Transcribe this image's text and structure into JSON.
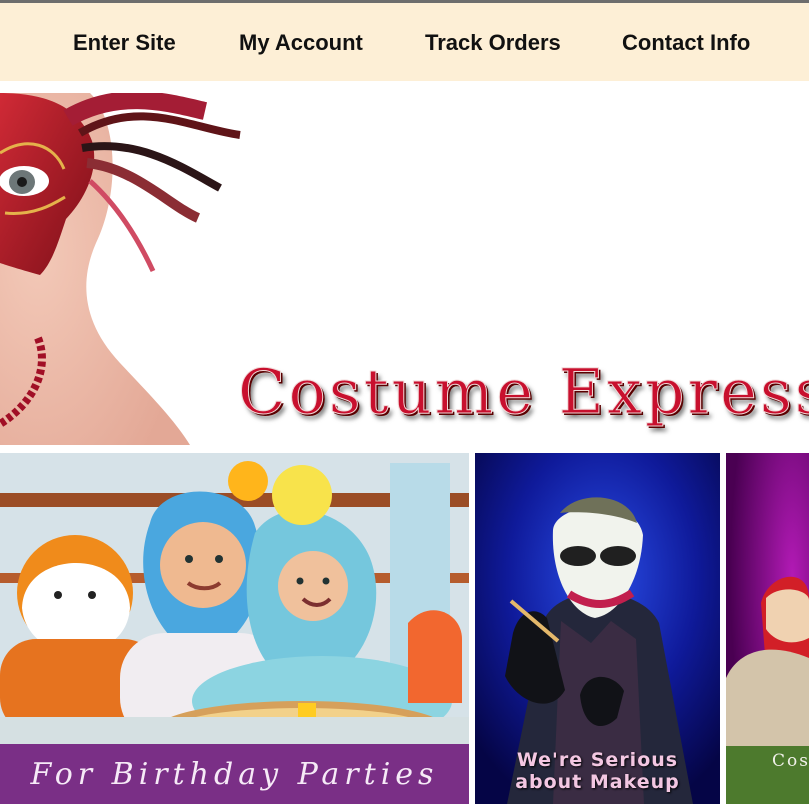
{
  "nav": {
    "items": [
      {
        "label": "Enter Site"
      },
      {
        "label": "My Account"
      },
      {
        "label": "Track Orders"
      },
      {
        "label": "Contact Info"
      }
    ]
  },
  "hero": {
    "brand": "Costume Express"
  },
  "tiles": [
    {
      "caption": "For Birthday Parties"
    },
    {
      "caption_line1": "We're Serious",
      "caption_line2": "about Makeup"
    },
    {
      "caption": "Cos"
    }
  ],
  "colors": {
    "nav_bg": "#fdefd6",
    "brand_red": "#c8102e",
    "birthday_bar": "#7a2f86",
    "makeup_bg": "#0a0b5e",
    "third_bar": "#4d7a2d"
  }
}
